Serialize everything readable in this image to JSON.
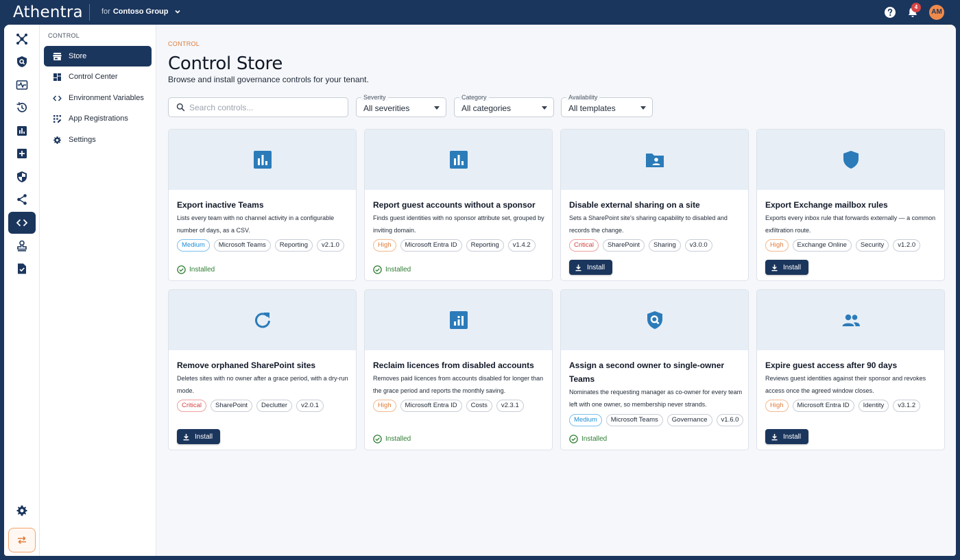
{
  "app": {
    "name": "Athentra",
    "tenant_prefix": "for",
    "tenant_name": "Contoso Group",
    "notification_count": "4",
    "user_initials": "AM"
  },
  "rail": {
    "icons": [
      "hub-icon",
      "shield-search-icon",
      "monitor-heart-icon",
      "history-icon",
      "bar-chart-icon",
      "add-box-icon",
      "security-icon",
      "share-icon",
      "code-icon",
      "stamp-icon",
      "task-icon"
    ],
    "active": "code-icon",
    "bottom": [
      "settings-icon",
      "swap-icon"
    ]
  },
  "subnav": {
    "title": "CONTROL",
    "items": [
      {
        "label": "Store",
        "icon": "store-icon",
        "active": true
      },
      {
        "label": "Control Center",
        "icon": "dashboard-icon",
        "active": false
      },
      {
        "label": "Environment Variables",
        "icon": "code-icon",
        "active": false
      },
      {
        "label": "App Registrations",
        "icon": "app-registration-icon",
        "active": false
      },
      {
        "label": "Settings",
        "icon": "settings-icon",
        "active": false
      }
    ]
  },
  "page": {
    "breadcrumb": "CONTROL",
    "title": "Control Store",
    "subtitle": "Browse and install governance controls for your tenant."
  },
  "filters": {
    "search_placeholder": "Search controls...",
    "search_value": "",
    "severity": {
      "label": "Severity",
      "value": "All severities"
    },
    "category": {
      "label": "Category",
      "value": "All categories"
    },
    "availability": {
      "label": "Availability",
      "value": "All templates"
    }
  },
  "status_labels": {
    "installed": "Installed",
    "install": "Install"
  },
  "colors": {
    "brand": "#1b365d",
    "accent": "#f08a4b",
    "banner": "#e7eef6",
    "icon": "#2b7bb9",
    "installed": "#2e7d32"
  },
  "cards": [
    {
      "title": "Export inactive Teams",
      "description": "Lists every team with no channel activity in a configurable number of days, as a CSV.",
      "icon": "bar-chart-icon",
      "severity": "Medium",
      "tags": [
        "Microsoft Teams",
        "Reporting"
      ],
      "version": "v2.1.0",
      "installed": true
    },
    {
      "title": "Report guest accounts without a sponsor",
      "description": "Finds guest identities with no sponsor attribute set, grouped by inviting domain.",
      "icon": "bar-chart-icon",
      "severity": "High",
      "tags": [
        "Microsoft Entra ID",
        "Reporting"
      ],
      "version": "v1.4.2",
      "installed": true
    },
    {
      "title": "Disable external sharing on a site",
      "description": "Sets a SharePoint site's sharing capability to disabled and records the change.",
      "icon": "folder-shared-icon",
      "severity": "Critical",
      "tags": [
        "SharePoint",
        "Sharing"
      ],
      "version": "v3.0.0",
      "installed": false
    },
    {
      "title": "Export Exchange mailbox rules",
      "description": "Exports every inbox rule that forwards externally — a common exfiltration route.",
      "icon": "shield-icon",
      "severity": "High",
      "tags": [
        "Exchange Online",
        "Security"
      ],
      "version": "v1.2.0",
      "installed": false
    },
    {
      "title": "Remove orphaned SharePoint sites",
      "description": "Deletes sites with no owner after a grace period, with a dry-run mode.",
      "icon": "refresh-icon",
      "severity": "Critical",
      "tags": [
        "SharePoint",
        "Declutter"
      ],
      "version": "v2.0.1",
      "installed": false
    },
    {
      "title": "Reclaim licences from disabled accounts",
      "description": "Removes paid licences from accounts disabled for longer than the grace period and reports the monthly saving.",
      "icon": "analytics-icon",
      "severity": "High",
      "tags": [
        "Microsoft Entra ID",
        "Costs"
      ],
      "version": "v2.3.1",
      "installed": true
    },
    {
      "title": "Assign a second owner to single-owner Teams",
      "description": "Nominates the requesting manager as co-owner for every team left with one owner, so membership never strands.",
      "icon": "shield-search-icon",
      "severity": "Medium",
      "tags": [
        "Microsoft Teams",
        "Governance"
      ],
      "version": "v1.6.0",
      "installed": true
    },
    {
      "title": "Expire guest access after 90 days",
      "description": "Reviews guest identities against their sponsor and revokes access once the agreed window closes.",
      "icon": "people-icon",
      "severity": "High",
      "tags": [
        "Microsoft Entra ID",
        "Identity"
      ],
      "version": "v3.1.2",
      "installed": false
    }
  ]
}
